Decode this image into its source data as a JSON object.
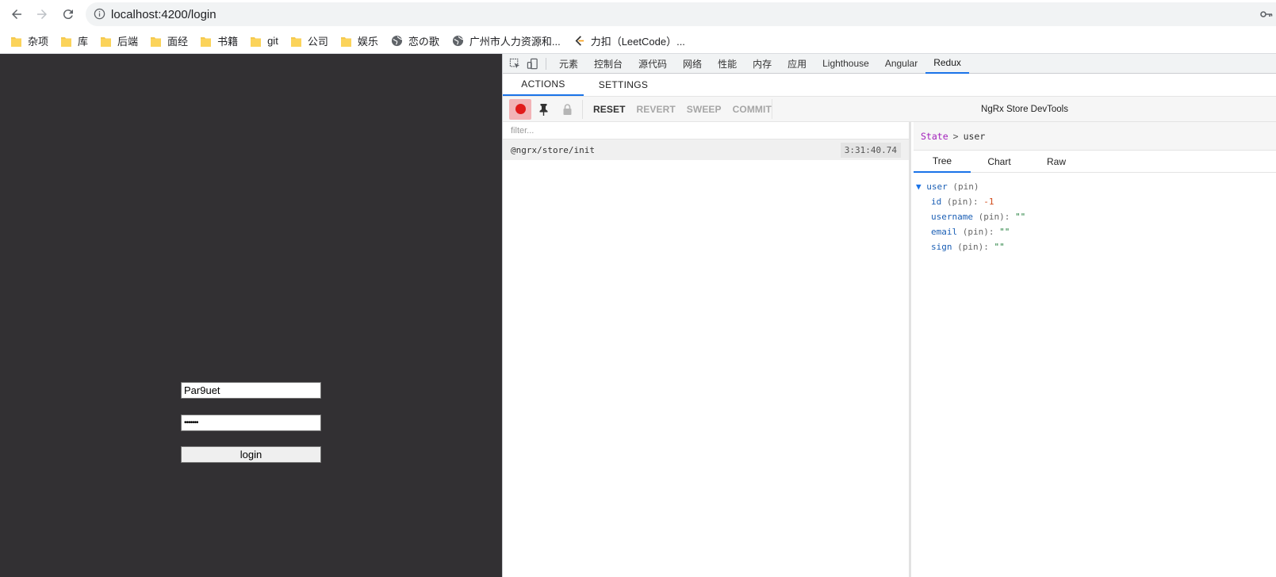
{
  "browser": {
    "url": "localhost:4200/login",
    "bookmarks": [
      {
        "label": "杂项",
        "icon": "folder-icon"
      },
      {
        "label": "库",
        "icon": "folder-icon"
      },
      {
        "label": "后端",
        "icon": "folder-icon"
      },
      {
        "label": "面经",
        "icon": "folder-icon"
      },
      {
        "label": "书籍",
        "icon": "folder-icon"
      },
      {
        "label": "git",
        "icon": "folder-icon"
      },
      {
        "label": "公司",
        "icon": "folder-icon"
      },
      {
        "label": "娱乐",
        "icon": "folder-icon"
      },
      {
        "label": "恋の歌",
        "icon": "globe-icon"
      },
      {
        "label": "广州市人力资源和...",
        "icon": "globe-icon"
      },
      {
        "label": "力扣（LeetCode）...",
        "icon": "leetcode-icon"
      }
    ]
  },
  "login": {
    "username_value": "Par9uet",
    "password_value": "•••••••",
    "button_label": "login"
  },
  "devtools": {
    "tabs": [
      "元素",
      "控制台",
      "源代码",
      "网络",
      "性能",
      "内存",
      "应用",
      "Lighthouse",
      "Angular",
      "Redux"
    ],
    "active_tab": "Redux",
    "redux_tabs": [
      "ACTIONS",
      "SETTINGS"
    ],
    "toolbar": {
      "reset": "RESET",
      "revert": "REVERT",
      "sweep": "SWEEP",
      "commit": "COMMIT",
      "title": "NgRx Store DevTools"
    },
    "filter_placeholder": "filter...",
    "actions": [
      {
        "type": "@ngrx/store/init",
        "time": "3:31:40.74"
      }
    ],
    "breadcrumb": {
      "root": "State",
      "separator": ">",
      "current": "user"
    },
    "state_tabs": [
      "Tree",
      "Chart",
      "Raw"
    ],
    "tree": {
      "root_key": "user",
      "root_suffix": "(pin)",
      "entries": [
        {
          "key": "id",
          "suffix": "(pin):",
          "value": "-1"
        },
        {
          "key": "username",
          "suffix": "(pin):",
          "value": "\"\""
        },
        {
          "key": "email",
          "suffix": "(pin):",
          "value": "\"\""
        },
        {
          "key": "sign",
          "suffix": "(pin):",
          "value": "\"\""
        }
      ]
    }
  },
  "colors": {
    "app_background": "#323033",
    "accent": "#1a73e8",
    "record": "#e11a1a"
  }
}
